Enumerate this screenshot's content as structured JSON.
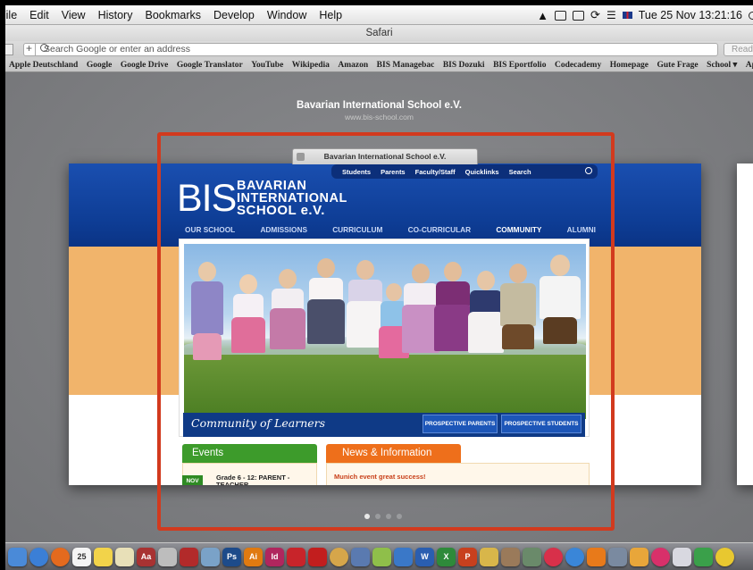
{
  "menubar": {
    "items": [
      "File",
      "Edit",
      "View",
      "History",
      "Bookmarks",
      "Develop",
      "Window",
      "Help"
    ],
    "datetime": "Tue 25 Nov  13:21:16"
  },
  "window": {
    "title": "Safari"
  },
  "toolbar": {
    "address_placeholder": "Search Google or enter an address",
    "reader_label": "Reader"
  },
  "bookmarks": [
    "Apple Deutschland",
    "Google",
    "Google Drive",
    "Google Translator",
    "YouTube",
    "Wikipedia",
    "Amazon",
    "BIS Managebac",
    "BIS Dozuki",
    "BIS Eportfolio",
    "Codecademy",
    "Homepage",
    "Gute Frage",
    "School ▾",
    "Apple"
  ],
  "tab_view": {
    "page_title": "Bavarian International School e.V.",
    "page_url": "www.bis-school.com",
    "tab_label": "Bavarian International School e.V.",
    "page_count": 4,
    "current_page": 1
  },
  "website": {
    "top_nav": [
      "Students",
      "Parents",
      "Faculty/Staff",
      "Quicklinks",
      "Search"
    ],
    "logo": "BIS",
    "school_name": [
      "BAVARIAN",
      "INTERNATIONAL",
      "SCHOOL e.V."
    ],
    "main_nav": [
      "OUR SCHOOL",
      "ADMISSIONS",
      "CURRICULUM",
      "CO-CURRICULAR",
      "COMMUNITY",
      "ALUMNI"
    ],
    "active_nav": "COMMUNITY",
    "tagline": "Community of Learners",
    "buttons": [
      "PROSPECTIVE PARENTS",
      "PROSPECTIVE STUDENTS"
    ],
    "events_heading": "Events",
    "news_heading": "News & Information",
    "event_month": "NOV",
    "event_text": "Grade 6 - 12: PARENT - TEACHER",
    "news_headline": "Munich event great success!",
    "colors": {
      "header_blue": "#0e3d95",
      "orange": "#f1b46b",
      "events_green": "#3d9b2b",
      "news_orange": "#ee6f1b"
    }
  },
  "dock": {
    "icons": [
      "finder-icon",
      "safari-icon",
      "firefox-icon",
      "calendar-icon",
      "stickies-icon",
      "notes-icon",
      "dictionary-icon",
      "calculator-icon",
      "photo-booth-icon",
      "preview-icon",
      "photoshop-icon",
      "illustrator-icon",
      "indesign-icon",
      "flash-icon",
      "acrobat-icon",
      "coda-icon",
      "xcode-icon",
      "textwrangler-icon",
      "keynote-icon",
      "word-icon",
      "excel-icon",
      "powerpoint-icon",
      "starfish-icon",
      "brushes-icon",
      "image-capture-icon",
      "itunes-icon",
      "app-store-icon",
      "vlc-icon",
      "tools-icon",
      "pages-icon",
      "music-icon",
      "mail-icon",
      "drive-icon",
      "chrome-icon"
    ]
  }
}
